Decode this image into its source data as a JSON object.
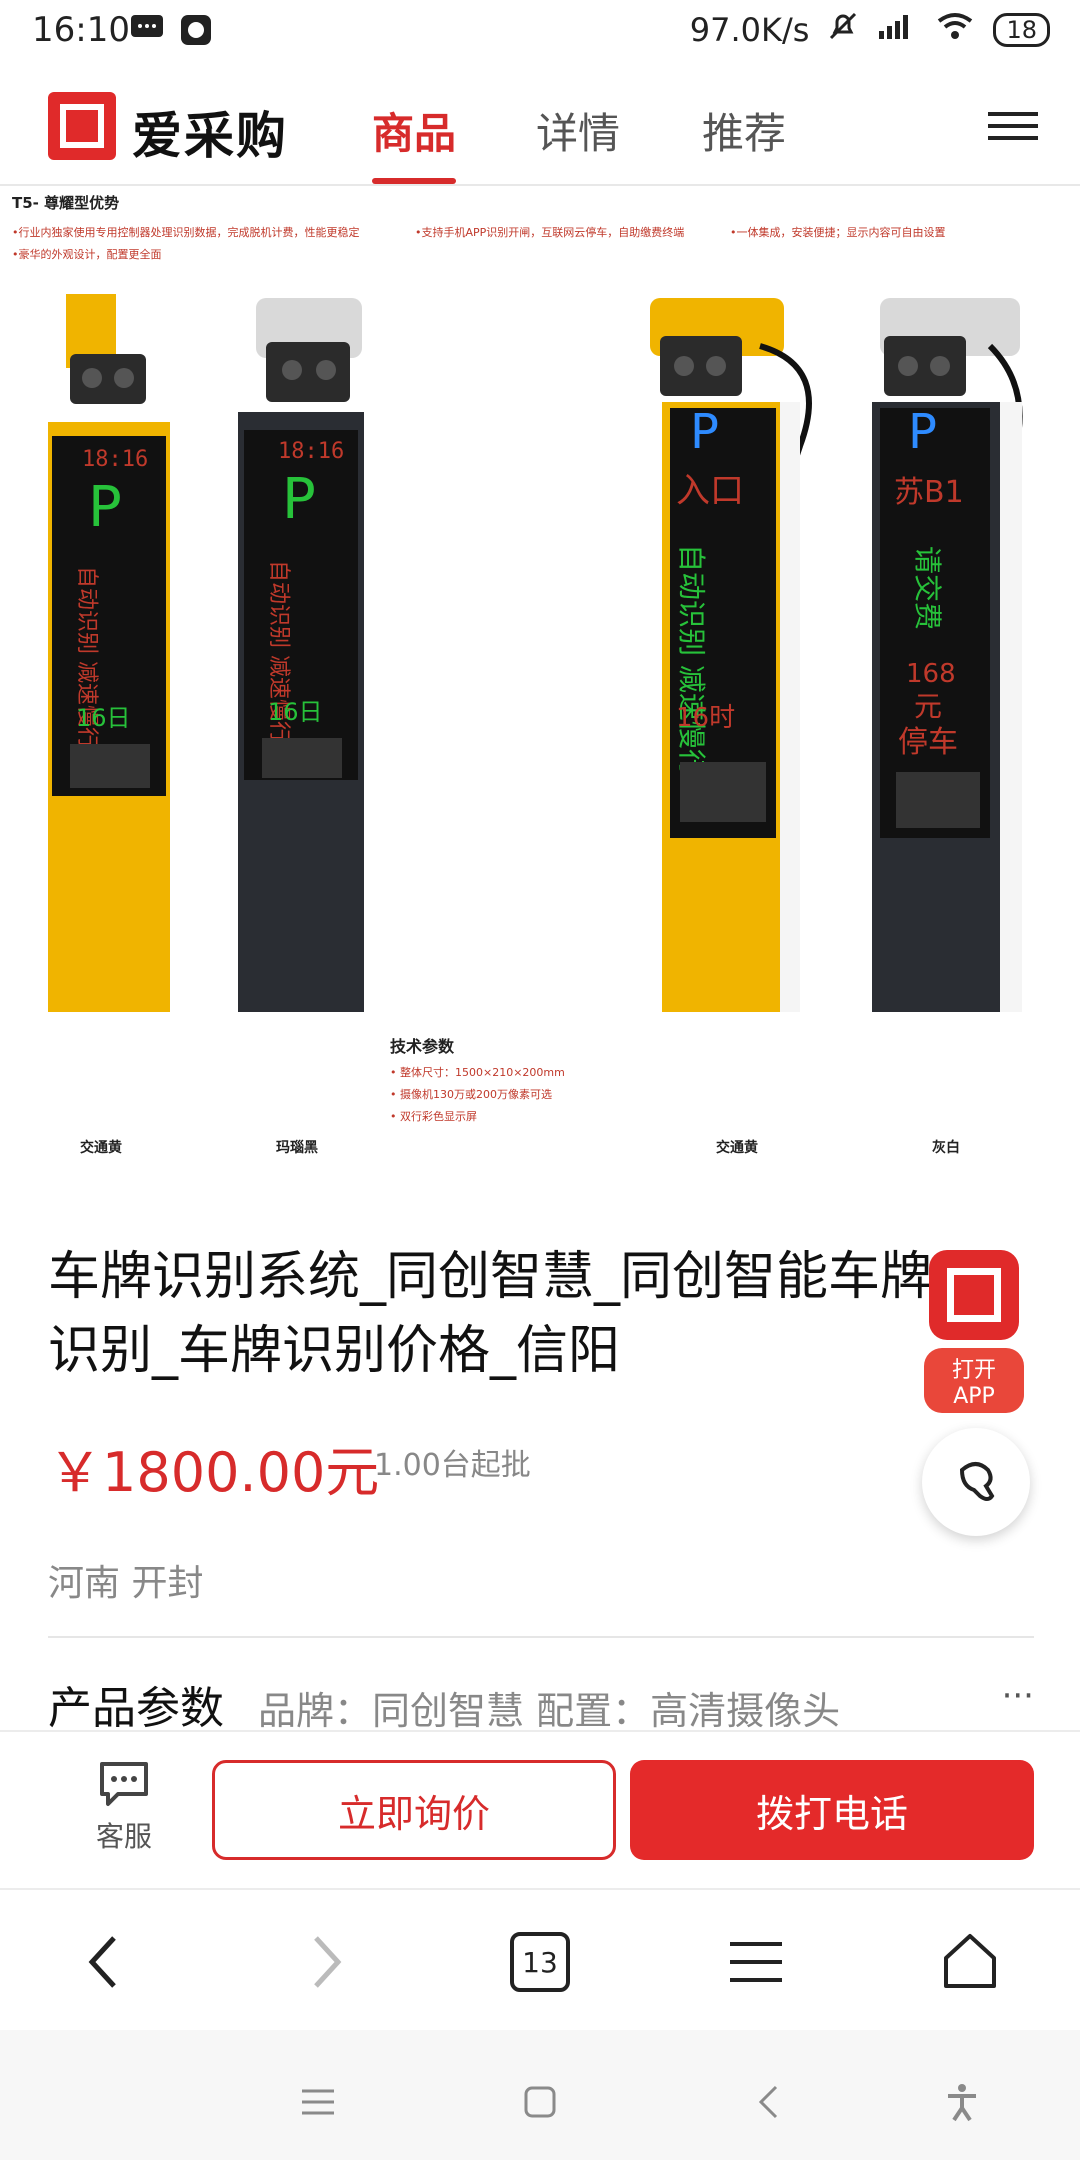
{
  "status_bar": {
    "time": "16:10",
    "network_speed": "97.0K/s",
    "battery": "18"
  },
  "header": {
    "logo_text": "爱采购",
    "tabs": [
      "商品",
      "详情",
      "推荐"
    ],
    "active_tab": "商品"
  },
  "product_image": {
    "banner_title": "T5- 尊耀型优势",
    "features": [
      "•行业内独家使用专用控制器处理识别数据，完成脱机计费，性能更稳定",
      "•支持手机APP识别开闸，互联网云停车，自助缴费终端",
      "•一体集成，安装便捷；显示内容可自由设置",
      "•豪华的外观设计，配置更全面"
    ],
    "spec_title": "技术参数",
    "specs": [
      "• 整体尺寸：1500×210×200mm",
      "• 摄像机130万或200万像素可选",
      "• 双行彩色显示屏"
    ],
    "colors": [
      "交通黄",
      "玛瑙黑",
      "交通黄",
      "灰白"
    ],
    "screens": [
      {
        "time": "18:16",
        "text": "自动识别 减速慢行",
        "date": "16日"
      },
      {
        "time": "18:16",
        "text": "自动识别 减速慢行",
        "date": "16日"
      },
      {
        "top": "入口",
        "text": "自动识别 减速慢行",
        "date": "16时"
      },
      {
        "top": "苏B1",
        "text": "请交费",
        "price": "168",
        "unit": "元",
        "bottom": "停车"
      }
    ],
    "p_letter": "P"
  },
  "product": {
    "title": "车牌识别系统_同创智慧_同创智能车牌识别_车牌识别价格_信阳",
    "price": "￥1800.00元",
    "moq": "1.00台起批",
    "location": "河南 开封",
    "params_label": "产品参数",
    "params_text": "品牌：同创智慧   配置：高清摄像头",
    "more": "···"
  },
  "open_app_label": "打开APP",
  "actions": {
    "service_label": "客服",
    "inquiry_label": "立即询价",
    "call_label": "拨打电话"
  },
  "browser": {
    "tab_count": "13"
  },
  "colors": {
    "brand_red": "#e02a2a",
    "accent_red": "#d72b2b",
    "pillar_yellow": "#f0b400",
    "pillar_black": "#2a2d33"
  }
}
